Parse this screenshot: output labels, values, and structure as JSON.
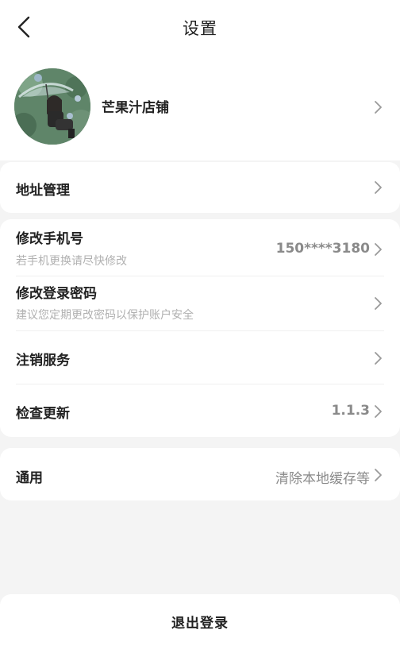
{
  "header": {
    "title": "设置"
  },
  "profile": {
    "shop_name": "芒果汁店铺"
  },
  "address": {
    "label": "地址管理"
  },
  "account": {
    "phone": {
      "label": "修改手机号",
      "hint": "若手机更换请尽快修改",
      "value": "150****3180"
    },
    "password": {
      "label": "修改登录密码",
      "hint": "建议您定期更改密码以保护账户安全"
    },
    "cancel": {
      "label": "注销服务"
    },
    "update": {
      "label": "检查更新",
      "value": "1.1.3"
    }
  },
  "general": {
    "label": "通用",
    "value": "清除本地缓存等"
  },
  "logout": {
    "label": "退出登录"
  },
  "colors": {
    "background": "#f4f4f4",
    "card": "#ffffff",
    "hint": "#b0b0b0",
    "chevron": "#9a9a9a"
  },
  "icons": [
    "back-arrow-icon",
    "chevron-right-icon"
  ]
}
